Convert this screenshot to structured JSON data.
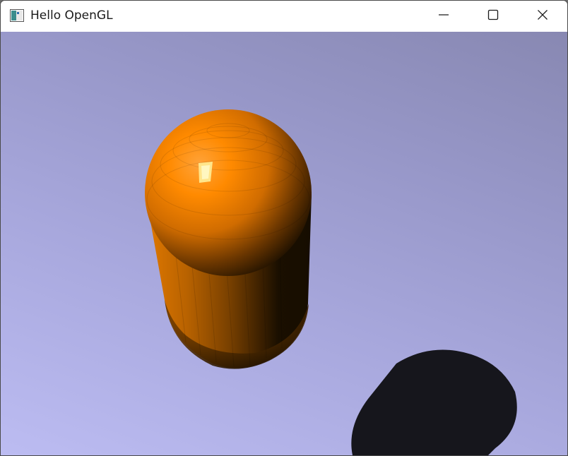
{
  "window": {
    "title": "Hello OpenGL",
    "icon": "opengl-app-icon",
    "controls": {
      "minimize_icon": "minimize-icon",
      "maximize_icon": "maximize-icon",
      "close_icon": "close-icon"
    }
  },
  "scene": {
    "background_top": "#8888b2",
    "background_bottom": "#bcbcf2",
    "object": "capsule",
    "object_color": "#ff8a00",
    "shadow_color": "#16161c"
  }
}
